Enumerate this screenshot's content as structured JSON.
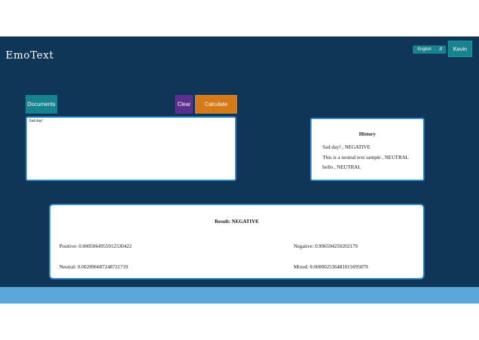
{
  "header": {
    "logo": "EmoText",
    "language": {
      "selected": "English",
      "icon": "updown-chevron-icon"
    },
    "user_button": "Kevin"
  },
  "toolbar": {
    "documents_label": "Documents",
    "clear_label": "Clear",
    "calculate_label": "Calculate"
  },
  "editor": {
    "value": "Sad day!"
  },
  "history": {
    "title": "History",
    "items": [
      "Sad day! , NEGATIVE",
      "This is a neutral text sample , NEUTRAL",
      "hello , NEUTRAL"
    ]
  },
  "result": {
    "title": "Result: NEGATIVE",
    "positive": "Positive: 0.0005064955912530422",
    "negative": "Negative: 0.996594250202179",
    "neutral": "Neutral: 0.002896687248721719",
    "mixed": "Mixed: 0.000002536481815695879"
  },
  "colors": {
    "background": "#0f3657",
    "teal_button": "#17838f",
    "purple_button": "#5b2e8f",
    "orange_button": "#d57a16",
    "card_border": "#2a86c8",
    "footer": "#5aa8d9"
  }
}
